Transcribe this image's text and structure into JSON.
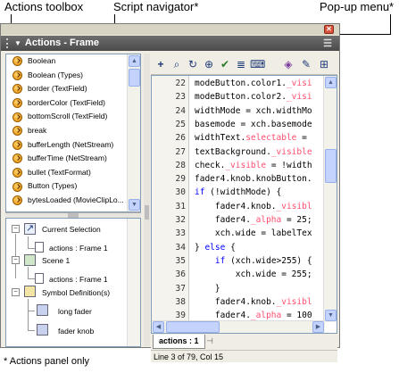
{
  "callouts": {
    "actions_toolbox": "Actions toolbox",
    "script_navigator": "Script navigator*",
    "popup_menu": "Pop-up menu*"
  },
  "panel": {
    "title": "Actions - Frame"
  },
  "toolbox": {
    "items": [
      "Boolean",
      "Boolean (Types)",
      "border (TextField)",
      "borderColor (TextField)",
      "bottomScroll (TextField)",
      "break",
      "bufferLength (NetStream)",
      "bufferTime (NetStream)",
      "bullet (TextFormat)",
      "Button (Types)",
      "bytesLoaded (MovieClipLo..."
    ]
  },
  "navigator": {
    "current_selection": "Current Selection",
    "current_item": "actions : Frame 1",
    "scene": "Scene 1",
    "scene_item": "actions : Frame 1",
    "symbols": "Symbol Definition(s)",
    "symbol_items": [
      "long fader",
      "fader knob"
    ]
  },
  "editor": {
    "lines": [
      {
        "n": "22",
        "html": "modeButton.color1.<span class=\"pr\">_visi</span>"
      },
      {
        "n": "23",
        "html": "modeButton.color2.<span class=\"pr\">_visi</span>"
      },
      {
        "n": "24",
        "html": "widthMode = xch.widthMo"
      },
      {
        "n": "25",
        "html": "basemode = xch.basemode"
      },
      {
        "n": "26",
        "html": "widthText.<span class=\"pr\">selectable</span> ="
      },
      {
        "n": "27",
        "html": "textBackground.<span class=\"pr\">_visible</span>"
      },
      {
        "n": "28",
        "html": "check.<span class=\"pr\">_visible</span> = !width"
      },
      {
        "n": "29",
        "html": "fader4.knob.knobButton."
      },
      {
        "n": "30",
        "html": "<span class=\"kw\">if</span> (!widthMode) {"
      },
      {
        "n": "31",
        "html": "    fader4.knob.<span class=\"pr\">_visibl</span>"
      },
      {
        "n": "32",
        "html": "    fader4.<span class=\"pr\">_alpha</span> = 25;"
      },
      {
        "n": "33",
        "html": "    xch.wide = labelTex"
      },
      {
        "n": "34",
        "html": "} <span class=\"kw\">else</span> {"
      },
      {
        "n": "35",
        "html": "    <span class=\"kw\">if</span> (xch.wide&gt;255) {"
      },
      {
        "n": "36",
        "html": "        xch.wide = 255;"
      },
      {
        "n": "37",
        "html": "    }"
      },
      {
        "n": "38",
        "html": "    fader4.knob.<span class=\"pr\">_visibl</span>"
      },
      {
        "n": "39",
        "html": "    fader4.<span class=\"pr\">_alpha</span> = 100"
      }
    ]
  },
  "script_tab": "actions : 1",
  "status": "Line 3 of 79, Col 15",
  "footnote": "* Actions panel only",
  "colors": {
    "keyword": "#0000ff",
    "property": "#ff4d6e",
    "titlebar": "#4a4a4a"
  }
}
